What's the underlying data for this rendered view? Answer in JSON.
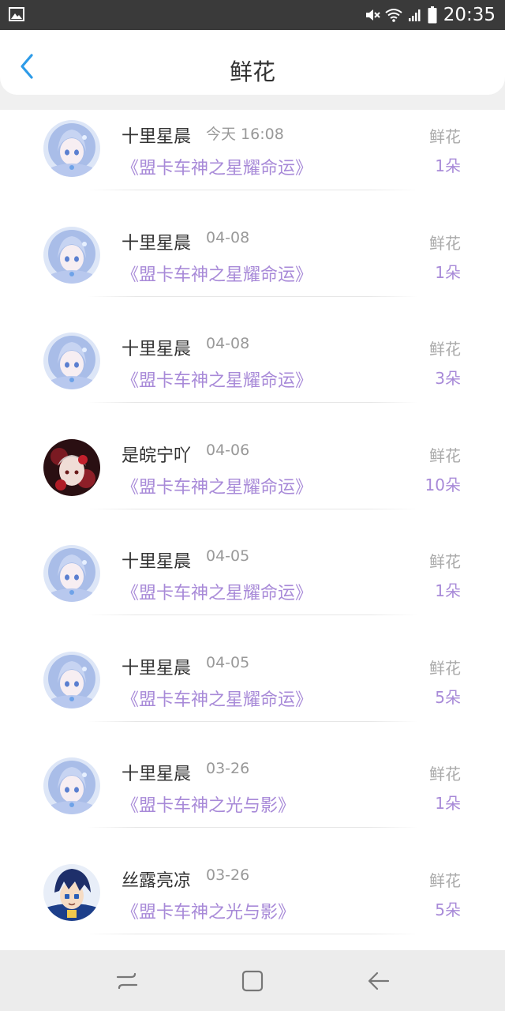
{
  "status_bar": {
    "time": "20:35",
    "icons": [
      "gallery-icon",
      "mute-icon",
      "wifi-icon",
      "signal-icon",
      "battery-icon"
    ]
  },
  "header": {
    "title": "鲜花",
    "back_icon": "chevron-left-icon",
    "accent_color": "#2d9be8"
  },
  "colors": {
    "title_purple": "#a88ad8",
    "muted_gray": "#999999"
  },
  "records": [
    {
      "user": "十里星晨",
      "date": "今天 16:08",
      "work": "《盟卡车神之星耀命运》",
      "gift": "鲜花",
      "count": "1朵",
      "avatar": "anime-girl-blue-avatar"
    },
    {
      "user": "十里星晨",
      "date": "04-08",
      "work": "《盟卡车神之星耀命运》",
      "gift": "鲜花",
      "count": "1朵",
      "avatar": "anime-girl-blue-avatar"
    },
    {
      "user": "十里星晨",
      "date": "04-08",
      "work": "《盟卡车神之星耀命运》",
      "gift": "鲜花",
      "count": "3朵",
      "avatar": "anime-girl-blue-avatar"
    },
    {
      "user": "是皖宁吖",
      "date": "04-06",
      "work": "《盟卡车神之星耀命运》",
      "gift": "鲜花",
      "count": "10朵",
      "avatar": "anime-girl-red-avatar"
    },
    {
      "user": "十里星晨",
      "date": "04-05",
      "work": "《盟卡车神之星耀命运》",
      "gift": "鲜花",
      "count": "1朵",
      "avatar": "anime-girl-blue-avatar"
    },
    {
      "user": "十里星晨",
      "date": "04-05",
      "work": "《盟卡车神之星耀命运》",
      "gift": "鲜花",
      "count": "5朵",
      "avatar": "anime-girl-blue-avatar"
    },
    {
      "user": "十里星晨",
      "date": "03-26",
      "work": "《盟卡车神之光与影》",
      "gift": "鲜花",
      "count": "1朵",
      "avatar": "anime-girl-blue-avatar"
    },
    {
      "user": "丝露亮凉",
      "date": "03-26",
      "work": "《盟卡车神之光与影》",
      "gift": "鲜花",
      "count": "5朵",
      "avatar": "anime-boy-blue-hair-avatar"
    }
  ],
  "nav_bar": {
    "buttons": [
      "recent-apps-icon",
      "home-icon",
      "back-arrow-icon"
    ]
  }
}
